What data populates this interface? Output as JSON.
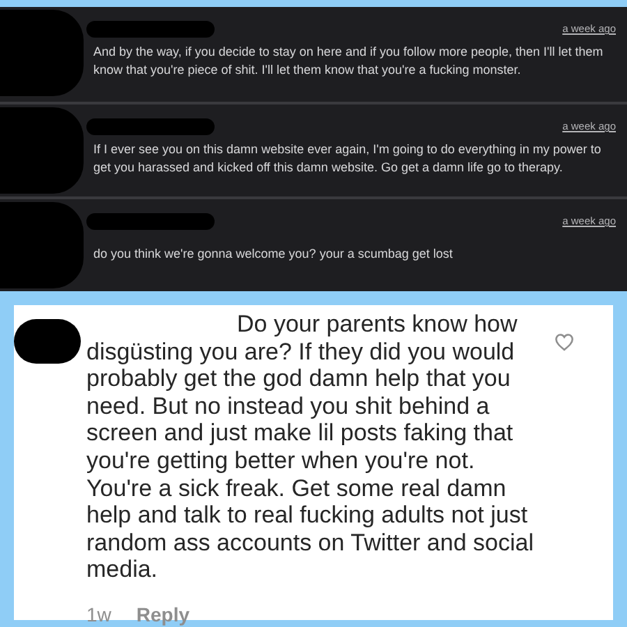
{
  "dark_comments": [
    {
      "time": "a week ago",
      "text": "And by the way, if you decide to stay on here and if you follow more people, then I'll let them know that you're piece of shit. I'll let them know that you're a fucking monster."
    },
    {
      "time": "a week ago",
      "text": "If I ever see you on this damn website ever again, I'm going to do everything in my power to get you harassed and kicked off this damn website. Go get a damn life go to therapy."
    },
    {
      "time": "a week ago",
      "text": "do you think we're gonna welcome you? your a scumbag get lost"
    }
  ],
  "light_comment": {
    "text": "Do your parents know how disgüsting you are? If they did you would probably get the god damn help that you need. But no instead you shit behind a screen and just make lil posts faking that you're getting better when you're not. You're a sick freak. Get some real damn help and talk to real fucking adults not just random ass accounts on Twitter and social media.",
    "time": "1w",
    "reply": "Reply"
  }
}
